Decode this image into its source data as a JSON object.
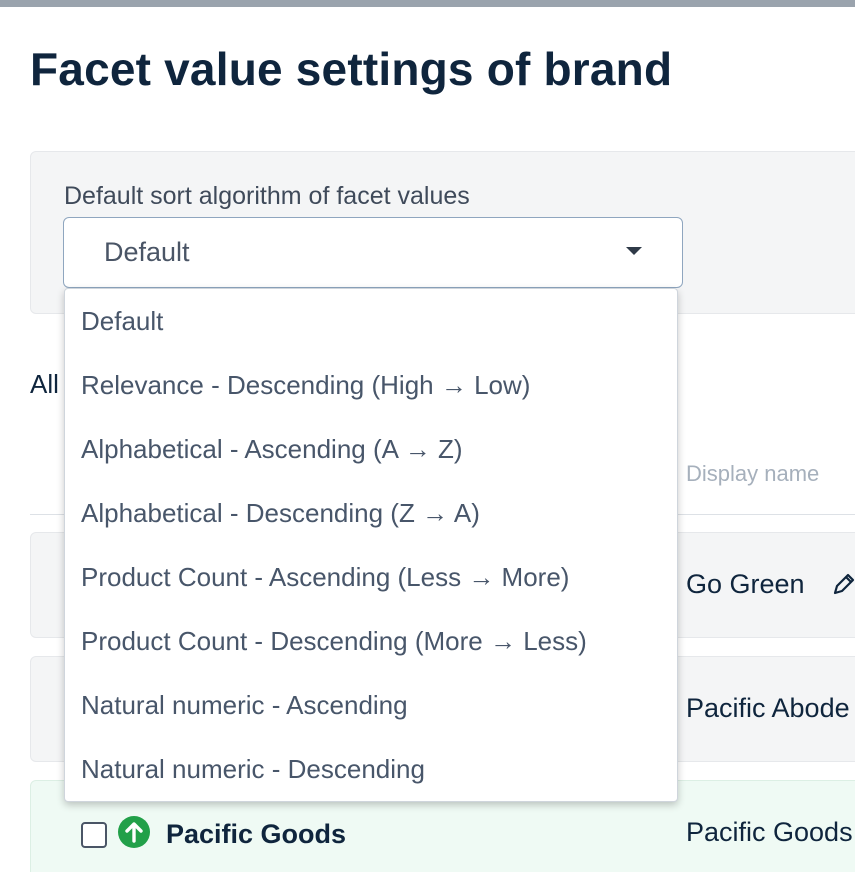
{
  "page": {
    "title": "Facet value settings of brand"
  },
  "settings": {
    "label": "Default sort algorithm of facet values",
    "selected_value": "Default"
  },
  "dropdown": {
    "options": [
      "Default",
      "Relevance - Descending (High → Low)",
      "Alphabetical - Ascending (A → Z)",
      "Alphabetical - Descending (Z → A)",
      "Product Count - Ascending (Less → More)",
      "Product Count - Descending (More → Less)",
      "Natural numeric - Ascending",
      "Natural numeric - Descending"
    ]
  },
  "list": {
    "all_label": "All",
    "column_header": "Display name",
    "rows": [
      {
        "display_name": "Go Green"
      },
      {
        "display_name": "Pacific Abode"
      },
      {
        "name": "Pacific Goods",
        "display_name": "Pacific Goods"
      }
    ]
  },
  "colors": {
    "title": "#0f253d",
    "panel_bg": "#f4f5f6",
    "highlight_row_bg": "#effaf4",
    "accent_green": "#22a049"
  },
  "icons": [
    "chevron-down-icon",
    "pencil-icon",
    "arrow-up-circle-icon"
  ]
}
